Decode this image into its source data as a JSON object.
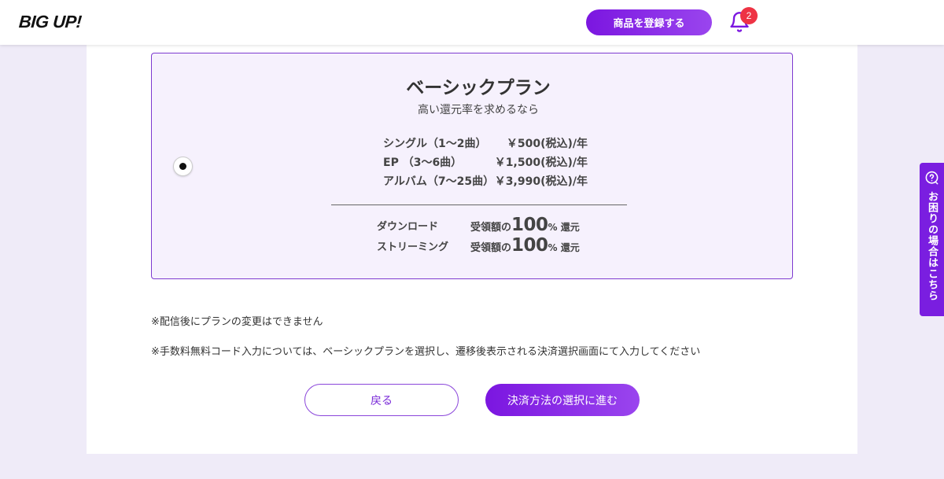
{
  "header": {
    "logo": "BIG UP!",
    "register_label": "商品を登録する",
    "notification_count": "2"
  },
  "plan": {
    "title": "ベーシックプラン",
    "subtitle": "高い還元率を求めるなら",
    "selected": true,
    "prices": [
      {
        "label": "シングル（1〜2曲）",
        "price": "￥500(税込)/年"
      },
      {
        "label": "EP （3〜6曲）",
        "price": "￥1,500(税込)/年"
      },
      {
        "label": "アルバム（7〜25曲）",
        "price": "￥3,990(税込)/年"
      }
    ],
    "rates": [
      {
        "label": "ダウンロード",
        "prefix": "受領額の",
        "value": "100",
        "suffix": "% 還元"
      },
      {
        "label": "ストリーミング",
        "prefix": "受領額の",
        "value": "100",
        "suffix": "% 還元"
      }
    ]
  },
  "notes": [
    "※配信後にプランの変更はできません",
    "※手数料無料コード入力については、ベーシックプランを選択し、遷移後表示される決済選択画面にて入力してください"
  ],
  "buttons": {
    "back": "戻る",
    "next": "決済方法の選択に進む"
  },
  "help_tab": {
    "label": "お困りの場合はこちら"
  },
  "colors": {
    "accent": "#7b16e0",
    "badge": "#ee3344",
    "card_bg": "#f6f1fd",
    "page_bg": "#efebf8"
  },
  "icons": {
    "bell": "bell-icon",
    "help": "question-bubble-icon"
  }
}
